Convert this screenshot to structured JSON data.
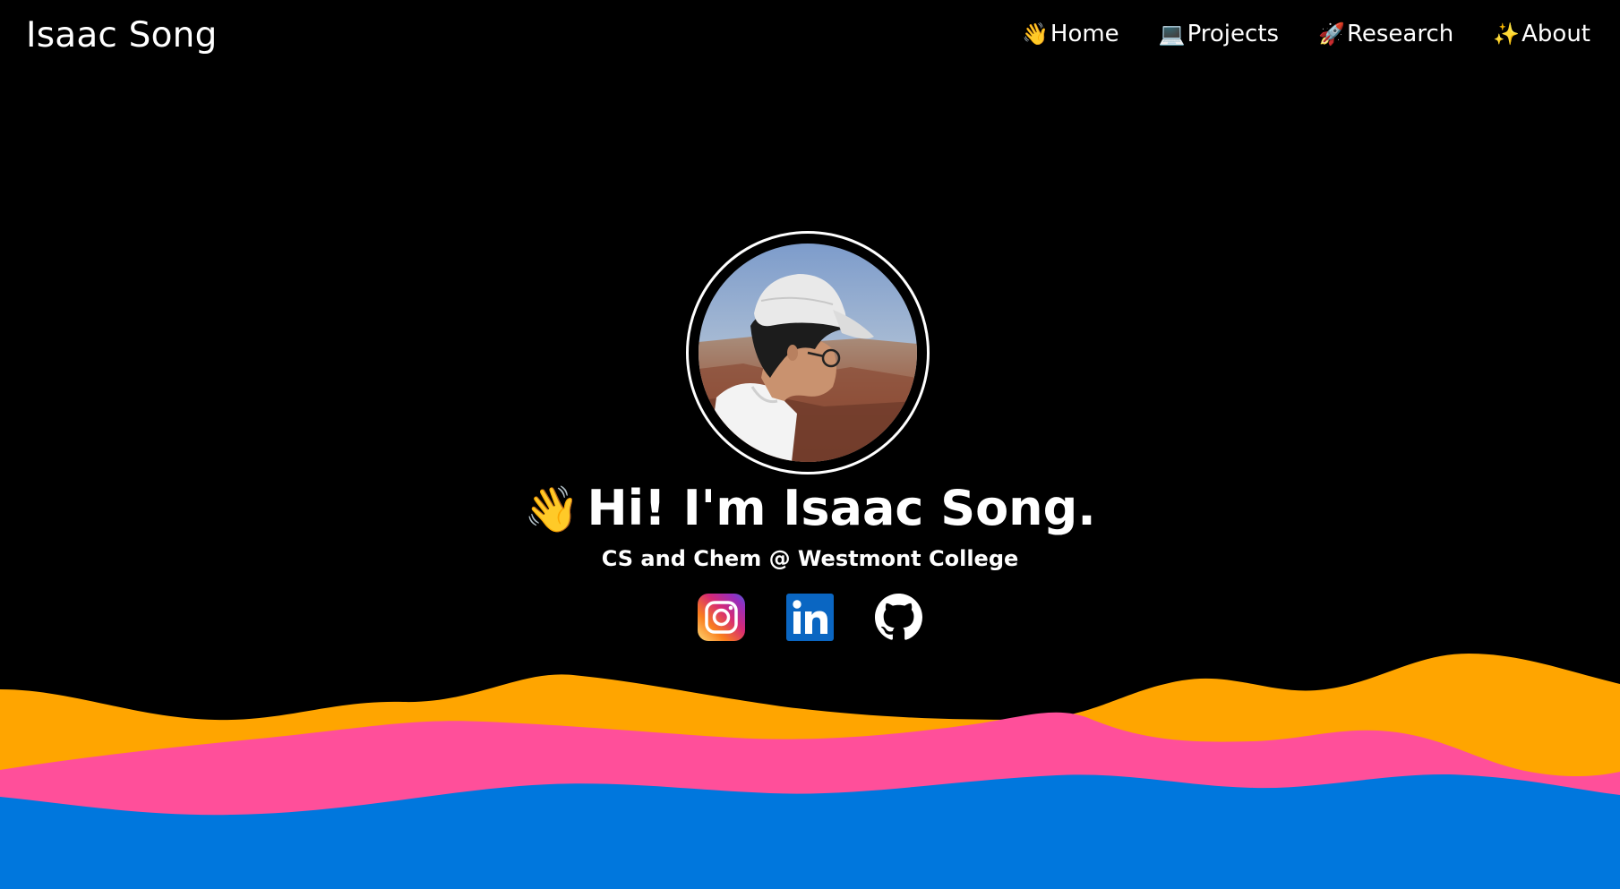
{
  "header": {
    "site_title": "Isaac Song",
    "nav": [
      {
        "icon": "👋",
        "label": "Home"
      },
      {
        "icon": "💻",
        "label": "Projects"
      },
      {
        "icon": "🚀",
        "label": "Research"
      },
      {
        "icon": "✨",
        "label": "About"
      }
    ]
  },
  "hero": {
    "wave_emoji": "👋",
    "greeting": "Hi! I'm Isaac Song.",
    "subtitle": "CS and Chem @ Westmont College"
  },
  "socials": [
    {
      "name": "instagram-icon"
    },
    {
      "name": "linkedin-icon"
    },
    {
      "name": "github-icon"
    }
  ],
  "colors": {
    "background": "#000000",
    "wave_orange": "#FFA500",
    "wave_pink": "#FF4F9A",
    "wave_blue": "#0077DD",
    "linkedin_blue": "#0A66C2"
  }
}
